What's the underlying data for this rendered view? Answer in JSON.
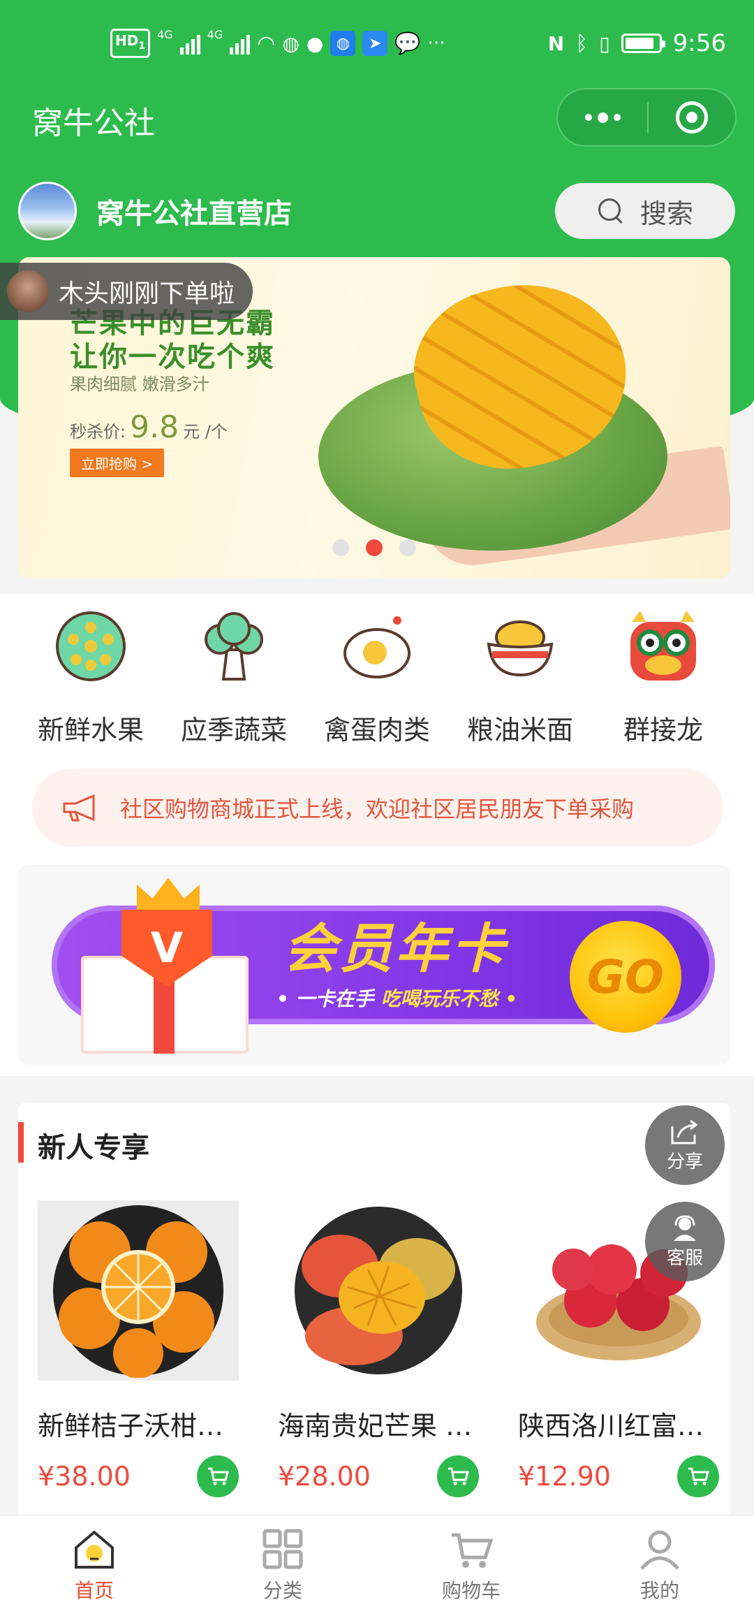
{
  "status_bar": {
    "network_badge": "HD",
    "network_badge_sub": "1",
    "sig1_label": "4G",
    "sig2_label": "4G",
    "time": "9:56"
  },
  "nav": {
    "title": "窝牛公社"
  },
  "shop": {
    "name": "窝牛公社直营店",
    "search_label": "搜索"
  },
  "banner": {
    "headline1": "芒果中的巨无霸",
    "headline2": "让你一次吃个爽",
    "subtitle": "果肉细腻 嫩滑多汁",
    "price_prefix": "秒杀价:",
    "price_value": "9.8",
    "price_unit": "元 /个",
    "cta": "立即抢购 >",
    "active_slide": 2,
    "slide_count": 3
  },
  "toast": {
    "text": "木头刚刚下单啦"
  },
  "categories": [
    {
      "label": "新鲜水果",
      "icon": "lotus-root-icon"
    },
    {
      "label": "应季蔬菜",
      "icon": "broccoli-icon"
    },
    {
      "label": "禽蛋肉类",
      "icon": "egg-icon"
    },
    {
      "label": "粮油米面",
      "icon": "rice-bowl-icon"
    },
    {
      "label": "群接龙",
      "icon": "lion-dance-icon"
    }
  ],
  "notice": {
    "text": "社区购物商城正式上线，欢迎社区居民朋友下单采购"
  },
  "member_card": {
    "title": "会员年卡",
    "slogan_part1": "• 一卡在手",
    "slogan_part2": "吃喝玩乐不愁 •",
    "go": "GO",
    "badge": "V"
  },
  "new_user": {
    "title": "新人专享",
    "products": [
      {
        "name": "新鲜桔子沃柑…",
        "price": "¥38.00",
        "image": "mandarin-oranges-image"
      },
      {
        "name": "海南贵妃芒果 …",
        "price": "¥28.00",
        "image": "mango-image"
      },
      {
        "name": "陕西洛川红富…",
        "price": "¥12.90",
        "image": "red-apples-image"
      }
    ]
  },
  "floating": {
    "share_label": "分享",
    "service_label": "客服"
  },
  "tabbar": [
    {
      "label": "首页",
      "icon": "home-icon",
      "active": true
    },
    {
      "label": "分类",
      "icon": "category-grid-icon",
      "active": false
    },
    {
      "label": "购物车",
      "icon": "cart-icon",
      "active": false
    },
    {
      "label": "我的",
      "icon": "user-icon",
      "active": false
    }
  ],
  "colors": {
    "brand_green": "#2dbb4e",
    "accent_red": "#ef4a3b",
    "member_purple": "#8136e6"
  }
}
